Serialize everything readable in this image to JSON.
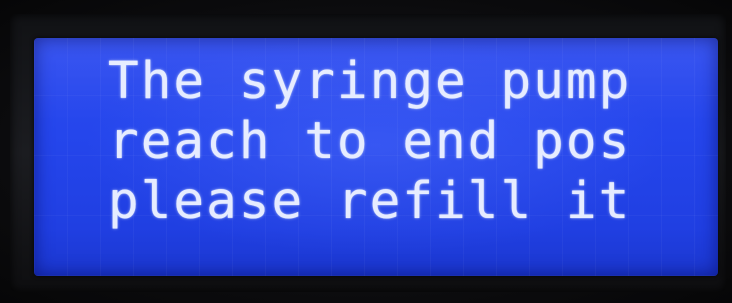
{
  "lcd": {
    "lines": [
      "The syringe pump",
      "reach to end pos",
      "please refill it"
    ]
  },
  "colors": {
    "backlight": "#2546ec",
    "text": "#e6ecff",
    "bezel": "#111215"
  }
}
